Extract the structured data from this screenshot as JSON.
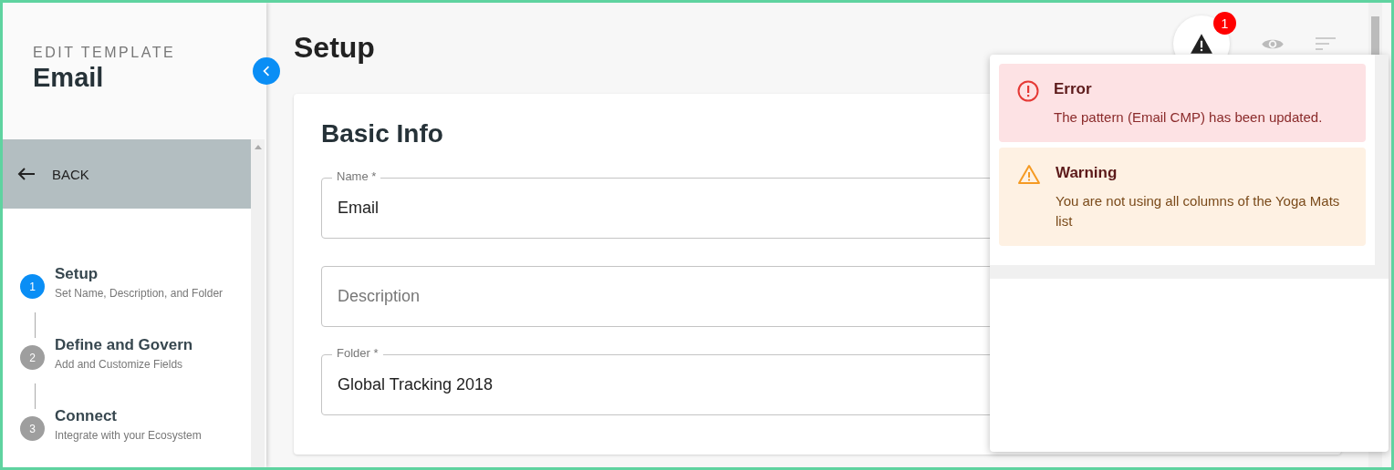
{
  "sidebar": {
    "subtitle": "EDIT TEMPLATE",
    "title": "Email",
    "back_label": "BACK",
    "steps": [
      {
        "number": "1",
        "title": "Setup",
        "subtitle": "Set Name, Description, and Folder",
        "selected": true
      },
      {
        "number": "2",
        "title": "Define and Govern",
        "subtitle": "Add and Customize Fields",
        "selected": false
      },
      {
        "number": "3",
        "title": "Connect",
        "subtitle": "Integrate with your Ecosystem",
        "selected": false
      }
    ]
  },
  "page_title": "Setup",
  "toolbar": {
    "alert_badge": "1"
  },
  "card": {
    "title": "Basic Info",
    "fields": [
      {
        "label": "Name *",
        "value": "Email"
      },
      {
        "placeholder": "Description"
      },
      {
        "label": "Folder *",
        "value": "Global Tracking 2018"
      }
    ]
  },
  "notifications": [
    {
      "kind": "error",
      "title": "Error",
      "message": "The pattern (Email CMP) has been updated."
    },
    {
      "kind": "warning",
      "title": "Warning",
      "message": "You are not using all columns of the Yoga Mats list"
    }
  ]
}
